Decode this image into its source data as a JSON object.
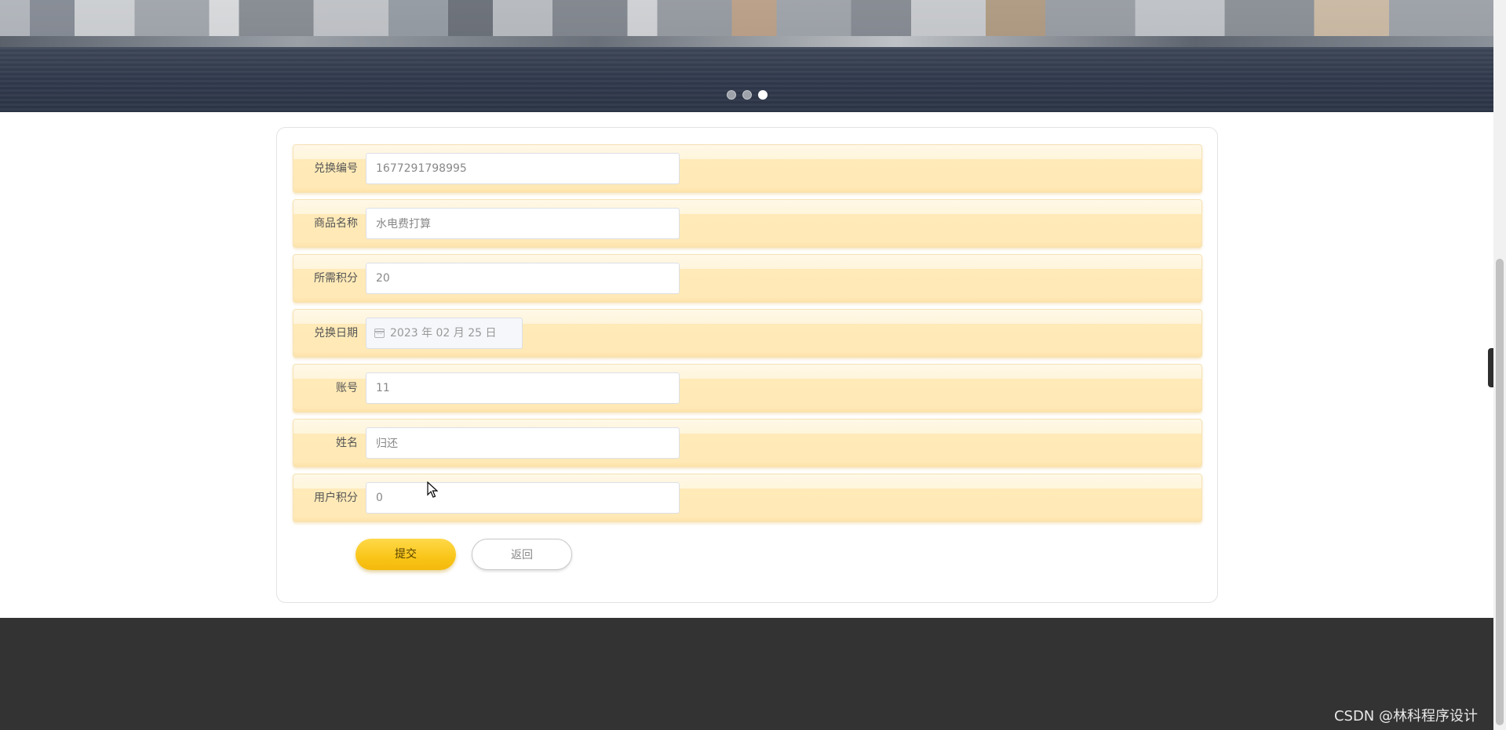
{
  "banner": {
    "slide_count": 3,
    "active_slide": 3
  },
  "form": {
    "fields": [
      {
        "label": "兑换编号",
        "value": "1677291798995",
        "type": "text"
      },
      {
        "label": "商品名称",
        "value": "水电费打算",
        "type": "text"
      },
      {
        "label": "所需积分",
        "value": "20",
        "type": "text"
      },
      {
        "label": "兑换日期",
        "value": "2023 年 02 月 25 日",
        "type": "date"
      },
      {
        "label": "账号",
        "value": "11",
        "type": "text"
      },
      {
        "label": "姓名",
        "value": "归还",
        "type": "text"
      },
      {
        "label": "用户积分",
        "value": "0",
        "type": "text"
      }
    ],
    "submit_label": "提交",
    "back_label": "返回"
  },
  "footer": {
    "watermark": "CSDN @林科程序设计"
  },
  "side_toggle": {
    "icon": "chevron-left-icon",
    "glyph": "‹"
  },
  "colors": {
    "row_fill": "#ffe9b6",
    "submit_button": "#f9c518",
    "footer_bg": "#333333"
  }
}
